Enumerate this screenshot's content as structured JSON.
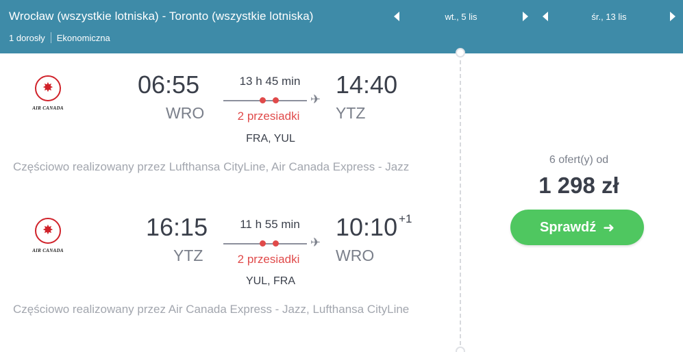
{
  "header": {
    "route": "Wrocław (wszystkie lotniska) - Toronto (wszystkie lotniska)",
    "passengers": "1 dorosły",
    "cabin": "Ekonomiczna",
    "outbound_date": "wt., 5 lis",
    "return_date": "śr., 13 lis"
  },
  "airline": {
    "name": "AIR CANADA",
    "brand_color": "#d0222a"
  },
  "outbound": {
    "dep_time": "06:55",
    "dep_code": "WRO",
    "duration": "13 h 45 min",
    "stops": "2 przesiadki",
    "arr_time": "14:40",
    "arr_code": "YTZ",
    "via": "FRA, YUL",
    "operated_by": "Częściowo realizowany przez Lufthansa CityLine, Air Canada Express - Jazz"
  },
  "inbound": {
    "dep_time": "16:15",
    "dep_code": "YTZ",
    "duration": "11 h 55 min",
    "stops": "2 przesiadki",
    "arr_time": "10:10",
    "arr_day_offset": "+1",
    "arr_code": "WRO",
    "via": "YUL, FRA",
    "operated_by": "Częściowo realizowany przez Air Canada Express - Jazz, Lufthansa CityLine"
  },
  "pricing": {
    "offers": "6 ofert(y) od",
    "price": "1 298 zł",
    "check_label": "Sprawdź"
  },
  "colors": {
    "header_bg": "#3e8ba8",
    "stops_red": "#e04a4a",
    "button_green": "#4fc760"
  }
}
